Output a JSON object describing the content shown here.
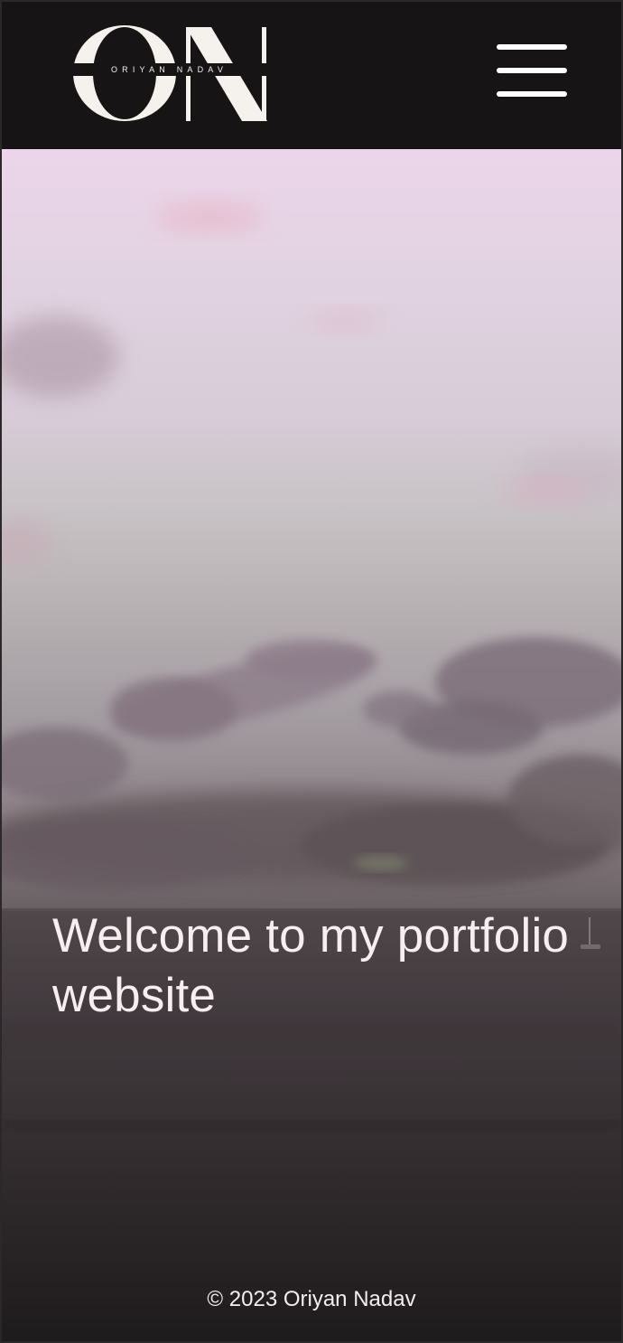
{
  "header": {
    "logo_monogram": "ON",
    "logo_text": "ORIYAN NADAV",
    "menu_icon": "hamburger-menu-icon"
  },
  "hero": {
    "title": "Welcome to my portfolio website",
    "background": "sunset sky over sea"
  },
  "footer": {
    "copyright": "© 2023 Oriyan Nadav"
  },
  "colors": {
    "header_bg": "#161415",
    "text_light": "#f7eef0"
  }
}
